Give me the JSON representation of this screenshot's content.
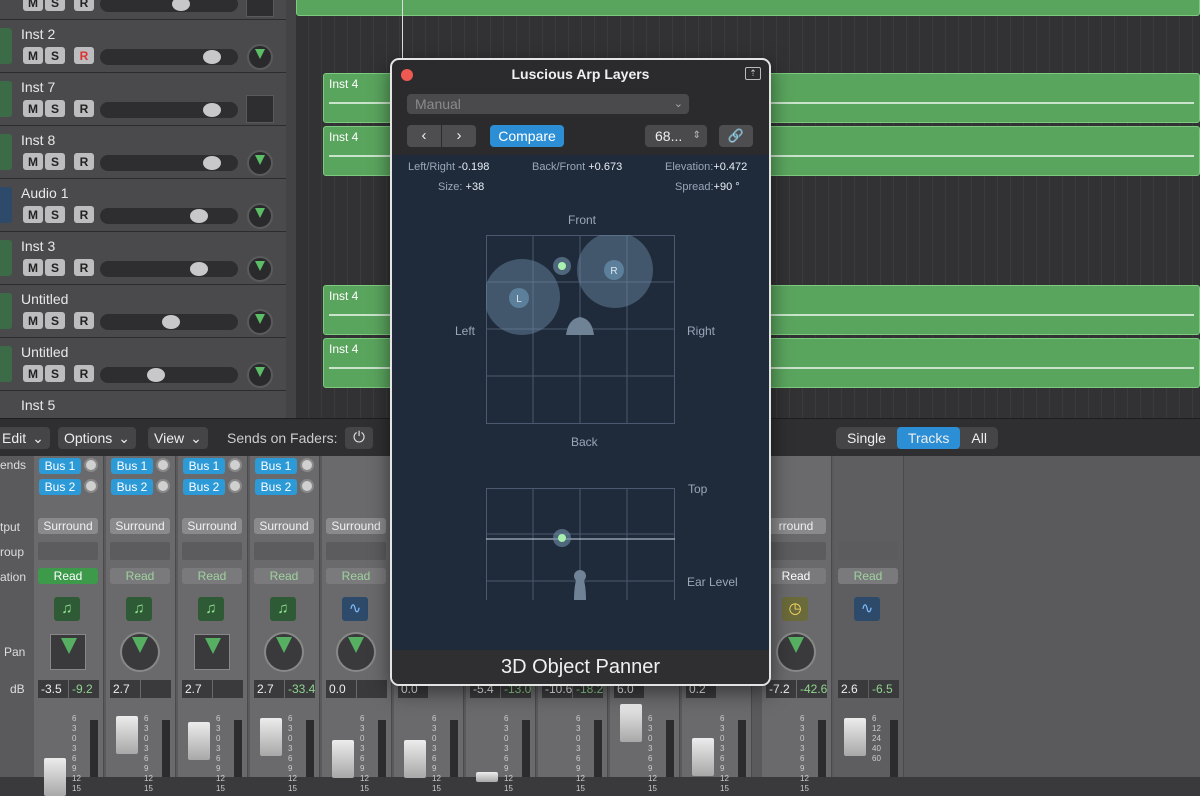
{
  "tracks": [
    {
      "name": "",
      "m": "M",
      "s": "S",
      "r": "R"
    },
    {
      "name": "Inst 2",
      "m": "M",
      "s": "S",
      "r": "R"
    },
    {
      "name": "Inst 7",
      "m": "M",
      "s": "S",
      "r": "R"
    },
    {
      "name": "Inst 8",
      "m": "M",
      "s": "S",
      "r": "R"
    },
    {
      "name": "Audio 1",
      "m": "M",
      "s": "S",
      "r": "R"
    },
    {
      "name": "Inst 3",
      "m": "M",
      "s": "S",
      "r": "R"
    },
    {
      "name": "Untitled",
      "m": "M",
      "s": "S",
      "r": "R"
    },
    {
      "name": "Untitled",
      "m": "M",
      "s": "S",
      "r": "R"
    },
    {
      "name": "Inst 5"
    }
  ],
  "regions": [
    "Inst 4",
    "Inst 4",
    "Inst 4",
    "Inst 4"
  ],
  "toolbar": {
    "edit": "Edit",
    "options": "Options",
    "view": "View",
    "sends_on_faders": "Sends on Faders:",
    "single": "Single",
    "tracks": "Tracks",
    "all": "All"
  },
  "mixer_labels": {
    "sends": "ends",
    "output": "tput",
    "group": "roup",
    "automation": "ation",
    "pan": "Pan",
    "db": "dB"
  },
  "strips": [
    {
      "send1": "Bus 1",
      "send2": "Bus 2",
      "output": "Surround",
      "auto": "Read",
      "db": "-3.5",
      "peak": "-9.2"
    },
    {
      "send1": "Bus 1",
      "send2": "Bus 2",
      "output": "Surround",
      "auto": "Read",
      "db": "2.7",
      "peak": ""
    },
    {
      "send1": "Bus 1",
      "send2": "Bus 2",
      "output": "Surround",
      "auto": "Read",
      "db": "2.7",
      "peak": ""
    },
    {
      "send1": "Bus 1",
      "send2": "Bus 2",
      "output": "Surround",
      "auto": "Read",
      "db": "2.7",
      "peak": "-33.4"
    },
    {
      "send1": "",
      "send2": "",
      "output": "Surround",
      "auto": "Read",
      "db": "0.0",
      "peak": ""
    },
    {
      "output": "",
      "auto": "",
      "db": "0.0",
      "peak": ""
    },
    {
      "output": "",
      "auto": "",
      "db": "-5.4",
      "peak": "-13.0"
    },
    {
      "output": "",
      "auto": "",
      "db": "-10.6",
      "peak": "-18.2"
    },
    {
      "output": "",
      "auto": "",
      "db": "6.0",
      "peak": ""
    },
    {
      "output": "",
      "auto": "",
      "db": "0.2",
      "peak": ""
    },
    {
      "output": "rround",
      "auto": "Read",
      "db": "-7.2",
      "peak": "-42.6"
    },
    {
      "output": "",
      "auto": "Read",
      "db": "2.6",
      "peak": "-6.5"
    }
  ],
  "fader_scale": [
    "6",
    "3",
    "0",
    "3",
    "6",
    "9",
    "12",
    "15"
  ],
  "fader_scale_alt": [
    "6",
    "3",
    "0",
    "3",
    "6",
    "9",
    "12",
    "15"
  ],
  "fader_scale_last": [
    "6",
    "12",
    "24",
    "40",
    "60"
  ],
  "plugin": {
    "title": "Luscious Arp Layers",
    "preset": "Manual",
    "compare": "Compare",
    "value": "68...",
    "left_right_label": "Left/Right",
    "left_right": "-0.198",
    "back_front_label": "Back/Front",
    "back_front": "+0.673",
    "elevation_label": "Elevation:",
    "elevation": "+0.472",
    "size_label": "Size:",
    "size": "+38",
    "spread_label": "Spread:",
    "spread": "+90 °",
    "front": "Front",
    "back": "Back",
    "left": "Left",
    "right": "Right",
    "top": "Top",
    "ear_level": "Ear Level",
    "l": "L",
    "r": "R",
    "footer": "3D Object Panner"
  }
}
